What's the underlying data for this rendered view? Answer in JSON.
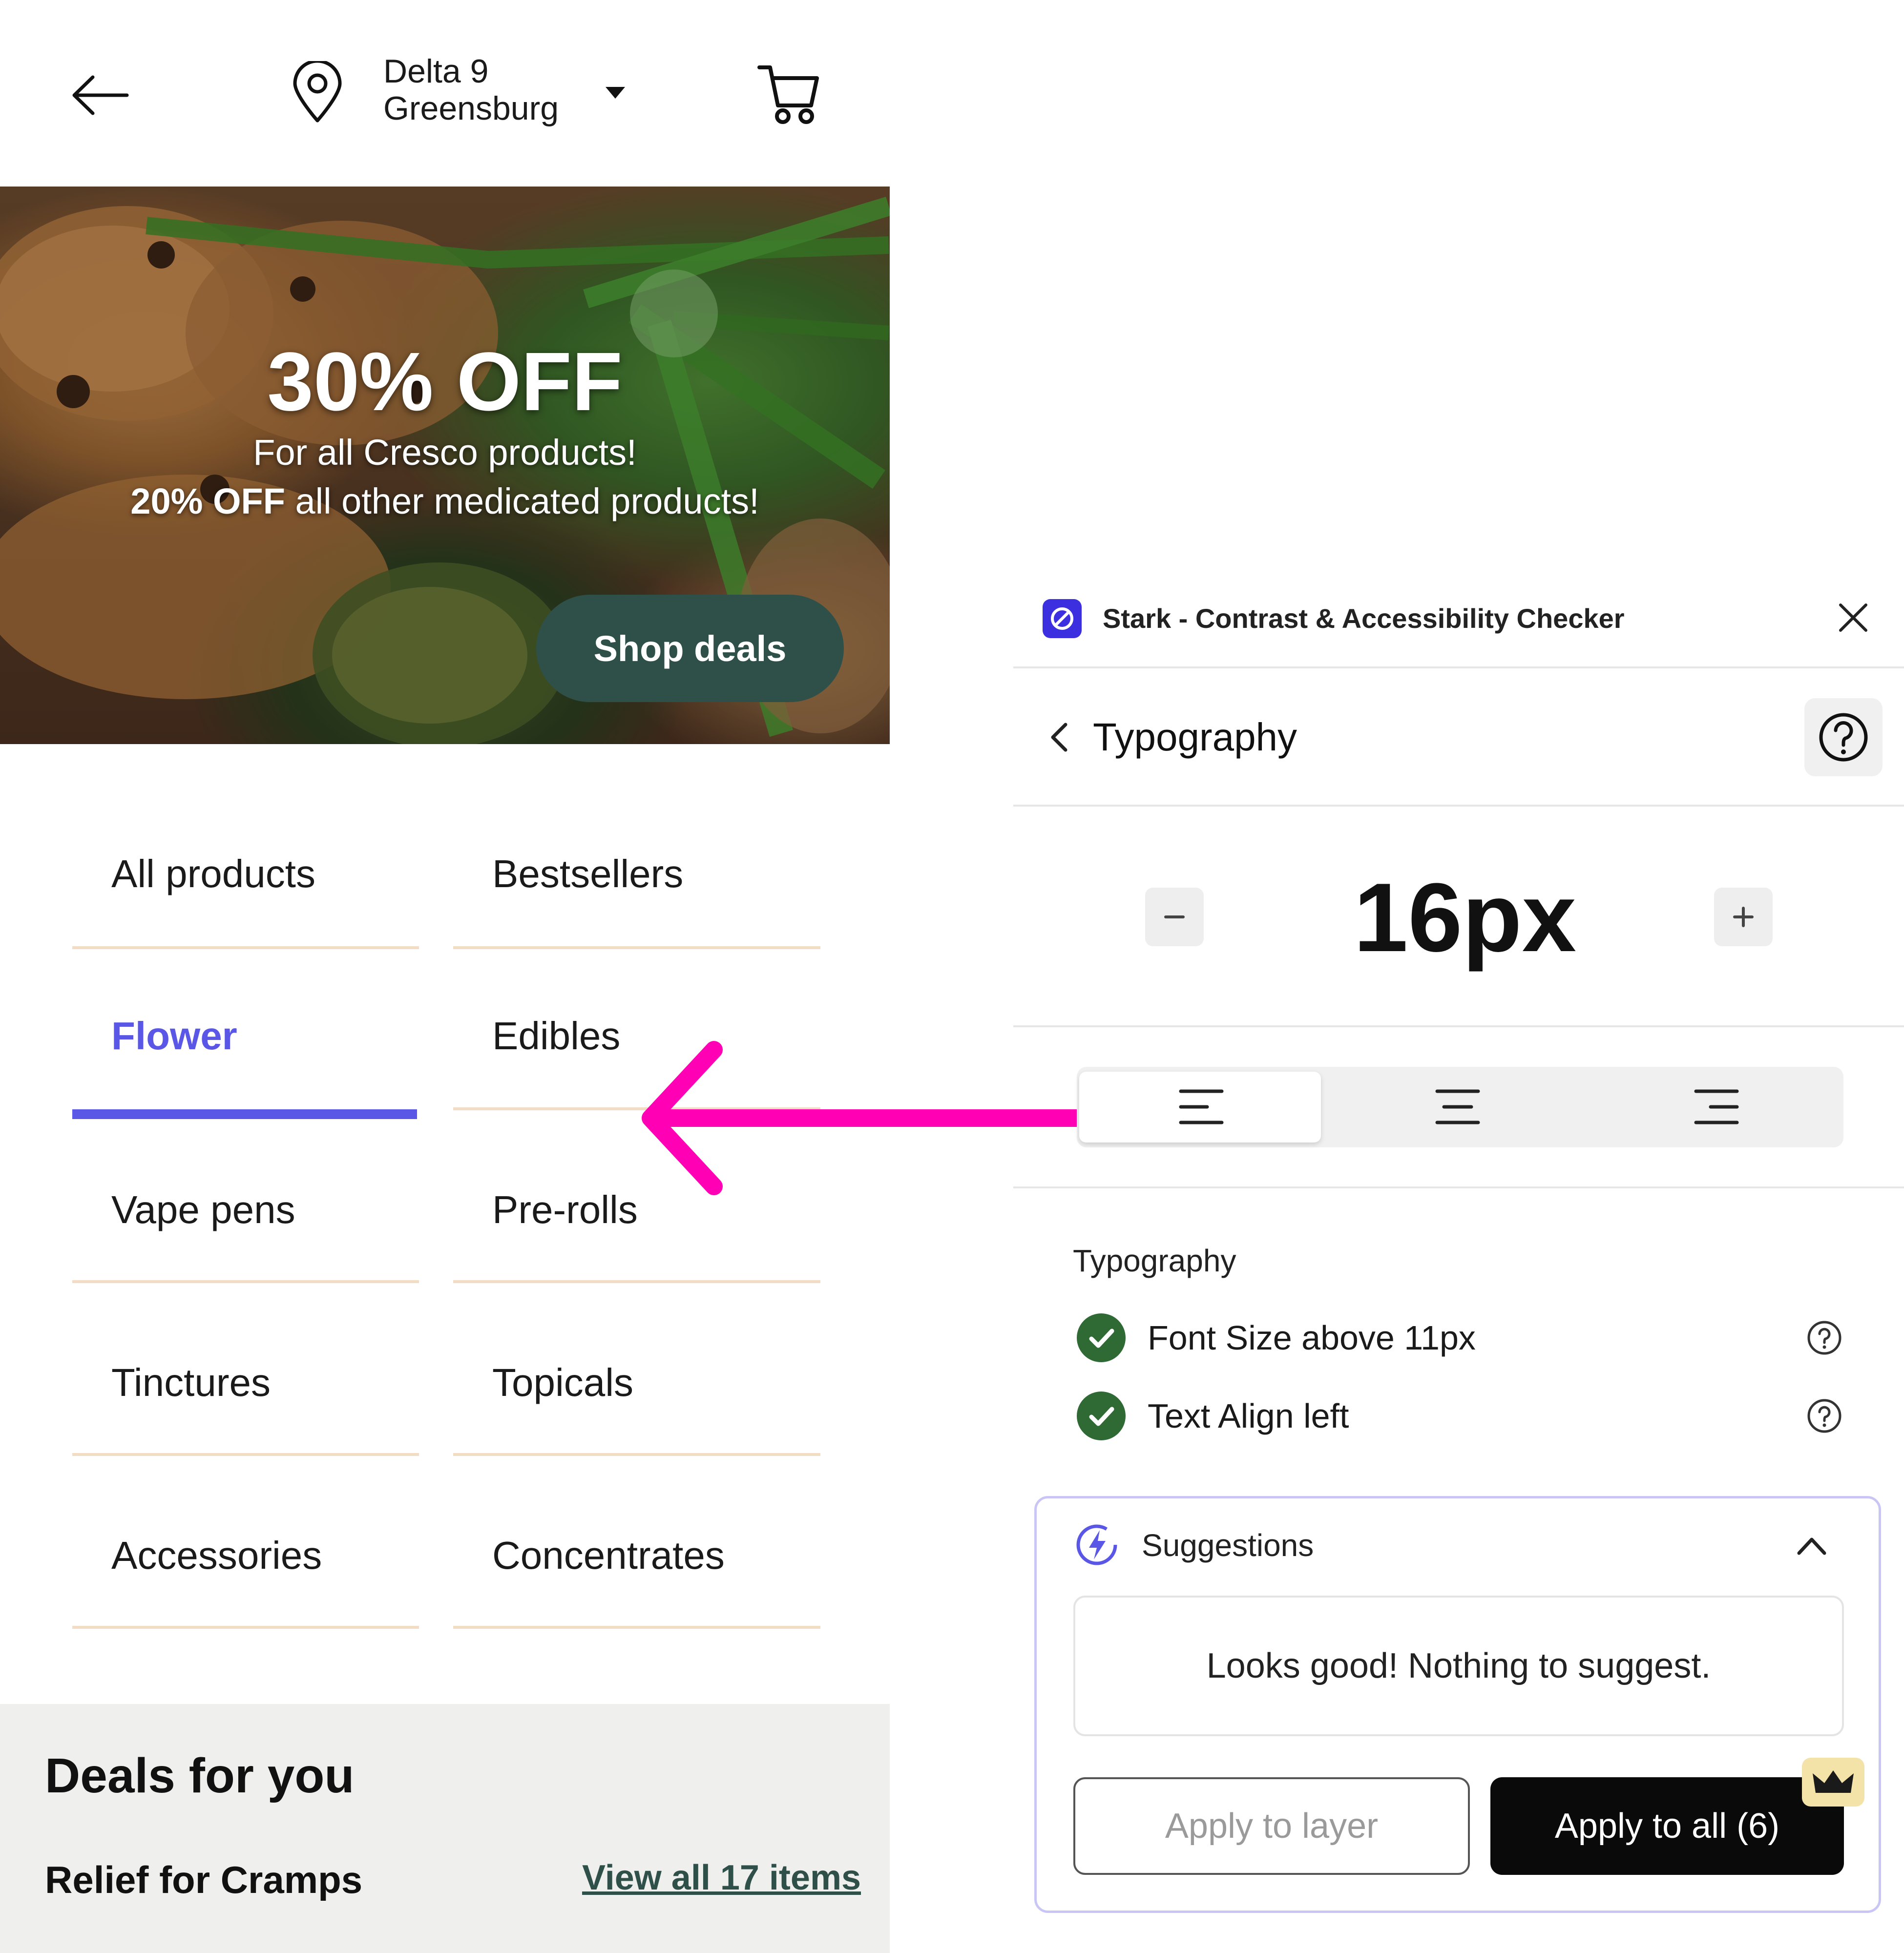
{
  "header": {
    "store_name": "Delta 9",
    "store_city": "Greensburg",
    "icons": {
      "back": "arrow-left-icon",
      "location": "map-pin-icon",
      "dropdown": "caret-down-icon",
      "cart": "shopping-cart-icon"
    }
  },
  "banner": {
    "title": "30% OFF",
    "line1": "For all Cresco products!",
    "line2_bold": "20% OFF",
    "line2_rest": " all other medicated products!",
    "cta": "Shop deals"
  },
  "categories": [
    {
      "label": "All products",
      "active": false
    },
    {
      "label": "Bestsellers",
      "active": false
    },
    {
      "label": "Flower",
      "active": true
    },
    {
      "label": "Edibles",
      "active": false
    },
    {
      "label": "Vape pens",
      "active": false
    },
    {
      "label": "Pre-rolls",
      "active": false
    },
    {
      "label": "Tinctures",
      "active": false
    },
    {
      "label": "Topicals",
      "active": false
    },
    {
      "label": "Accessories",
      "active": false
    },
    {
      "label": "Concentrates",
      "active": false
    }
  ],
  "deals": {
    "title": "Deals for you",
    "subtitle": "Relief for Cramps",
    "view_all": "View all 17 items"
  },
  "stark": {
    "title": "Stark - Contrast & Accessibility Checker",
    "section": "Typography",
    "font_size": "16px",
    "alignment_options": [
      "align-left-icon",
      "align-center-icon",
      "align-right-icon"
    ],
    "alignment_selected": "left",
    "checks_heading": "Typography",
    "checks": [
      {
        "label": "Font Size above 11px",
        "status": "pass"
      },
      {
        "label": "Text Align left",
        "status": "pass"
      }
    ],
    "suggestions": {
      "title": "Suggestions",
      "message": "Looks good! Nothing to suggest.",
      "apply_layer": "Apply to layer",
      "apply_all": "Apply to all (6)"
    }
  },
  "colors": {
    "accent": "#5b57e6",
    "deal_button": "#2f5049",
    "annotation_arrow": "#ff00b4",
    "pass_green": "#2f6a34"
  }
}
